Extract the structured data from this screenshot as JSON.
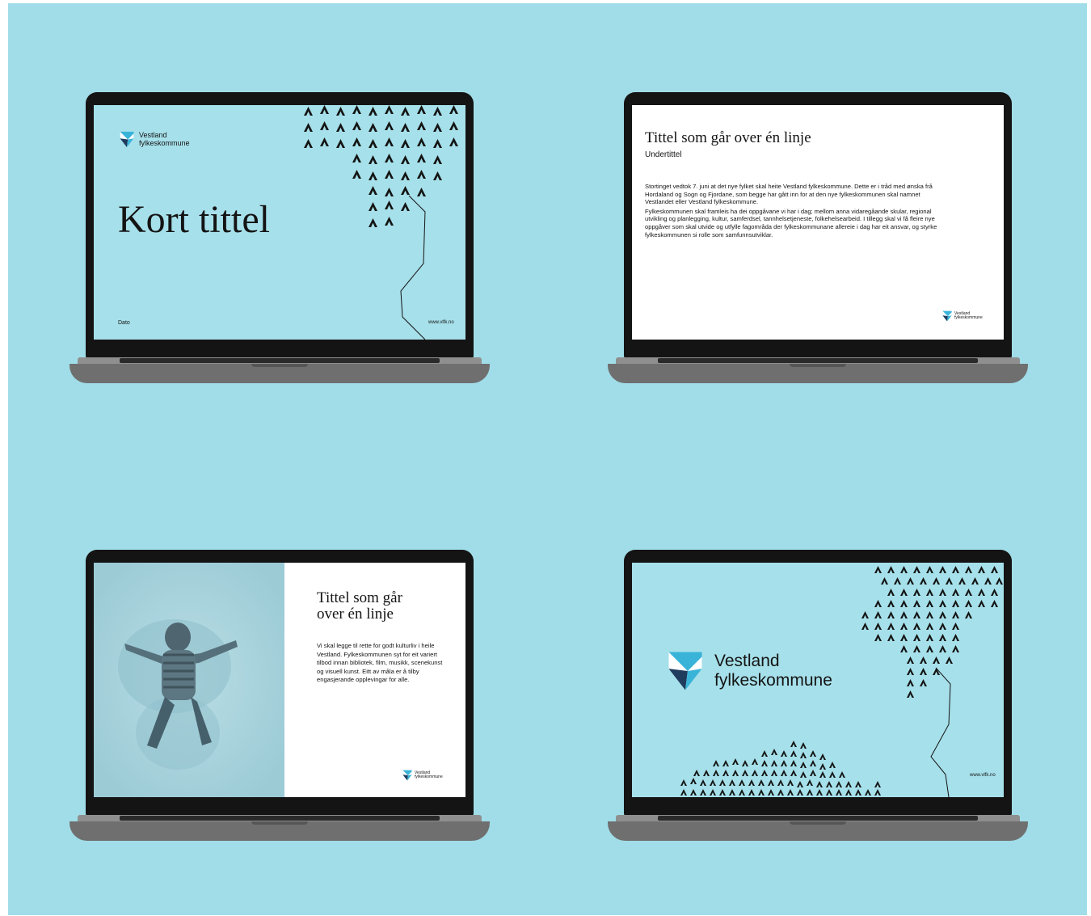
{
  "brand": {
    "line1": "Vestland",
    "line2": "fylkeskommune",
    "colors": {
      "blue": "#39b4d8",
      "navy": "#1f3c5e",
      "light": "#a6e0ea",
      "black": "#141414"
    }
  },
  "slides": {
    "title_slide": {
      "title": "Kort tittel",
      "date_label": "Dato",
      "url": "www.vlfk.no"
    },
    "text_slide": {
      "title": "Tittel som går over én linje",
      "subtitle": "Undertittel",
      "paragraph1": "Stortinget vedtok 7. juni at det nye fylket skal heite Vestland fylkeskommune. Dette er i tråd med ønska frå Hordaland og Sogn og Fjordane, som begge har gått inn for at den nye fylkeskommunen skal namnet Vestlandet eller Vestland fylkeskommune.",
      "paragraph2": "Fylkeskommunen skal framleis ha dei oppgåvane vi har i dag; mellom anna vidaregåande skular, regional utvikling og planlegging, kultur, samferdsel, tannhelsetjeneste, folkehelsearbeid. I tillegg skal vi få fleire nye oppgåver som skal utvide og utfylle fagområda der fylkeskommunane allereie i dag har eit ansvar, og styrke fylkeskommunen si rolle som samfunnsutviklar."
    },
    "image_slide": {
      "title_line1": "Tittel som går",
      "title_line2": "over én linje",
      "body": "Vi skal legge til rette for godt kulturliv i heile Vestland. Fylkeskommunen syt for eit variert tilbod innan bibliotek, film, musikk, scenekunst og visuell kunst. Eitt av måla er å tilby engasjerande opplevingar for alle."
    },
    "brand_slide": {
      "url": "www.vlfk.no"
    }
  },
  "icons": [
    "vestland-logo-icon",
    "mountain-pattern",
    "child-snow-angel-photo"
  ]
}
